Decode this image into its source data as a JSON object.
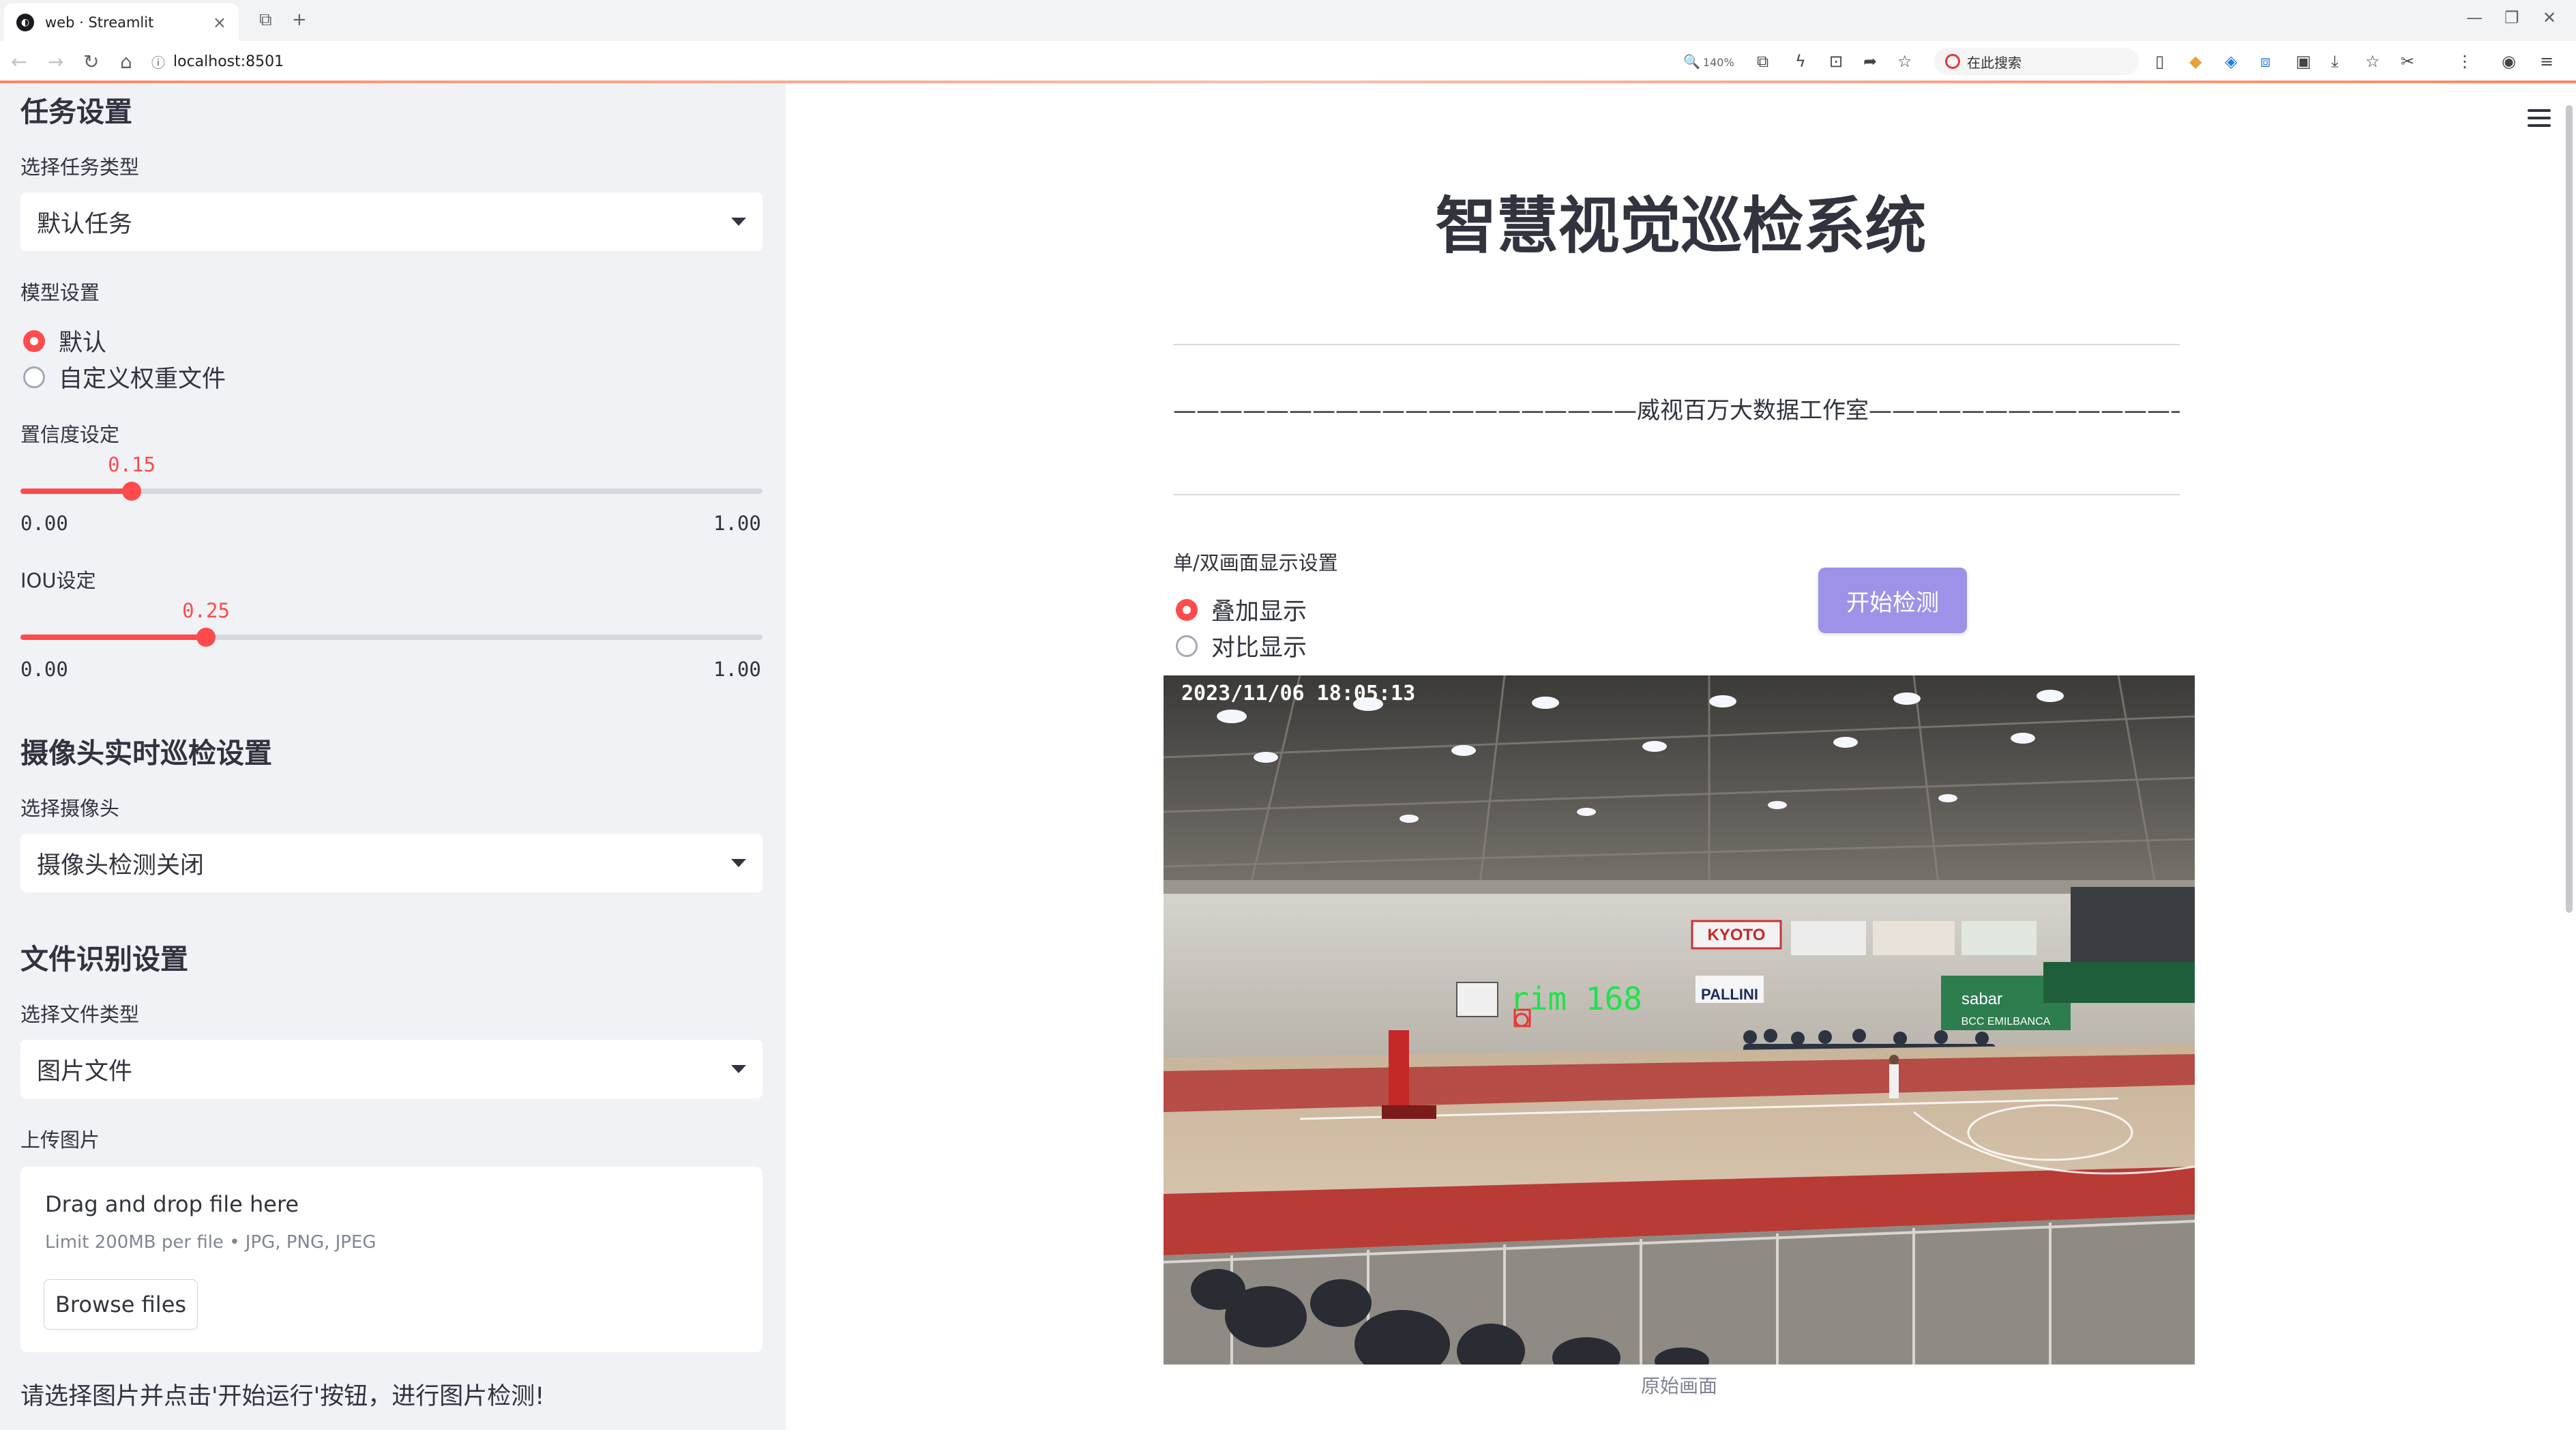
{
  "browser": {
    "tab_title": "web · Streamlit",
    "url": "localhost:8501",
    "zoom": "140%",
    "search_placeholder": "在此搜索"
  },
  "sidebar": {
    "task_header": "任务设置",
    "task_type_label": "选择任务类型",
    "task_type_value": "默认任务",
    "model_label": "模型设置",
    "model_options": [
      "默认",
      "自定义权重文件"
    ],
    "model_selected": 0,
    "confidence": {
      "label": "置信度设定",
      "value": "0.15",
      "min": "0.00",
      "max": "1.00",
      "fraction": 0.15
    },
    "iou": {
      "label": "IOU设定",
      "value": "0.25",
      "min": "0.00",
      "max": "1.00",
      "fraction": 0.25
    },
    "camera_header": "摄像头实时巡检设置",
    "camera_label": "选择摄像头",
    "camera_value": "摄像头检测关闭",
    "file_header": "文件识别设置",
    "file_type_label": "选择文件类型",
    "file_type_value": "图片文件",
    "upload_label": "上传图片",
    "upload_title": "Drag and drop file here",
    "upload_limit": "Limit 200MB per file • JPG, PNG, JPEG",
    "browse_label": "Browse files",
    "note": "请选择图片并点击'开始运行'按钮，进行图片检测!"
  },
  "main": {
    "title": "智慧视觉巡检系统",
    "studio_line": "————————————————————威视百万大数据工作室————————————————————",
    "display_mode_label": "单/双画面显示设置",
    "display_options": [
      "叠加显示",
      "对比显示"
    ],
    "display_selected": 0,
    "start_button": "开始检测",
    "frame_timestamp": "2023/11/06  18:05:13",
    "detection_label": "rim  168",
    "court_sign": "KYOTO",
    "court_sign_2": "PALLINI",
    "court_sign_3": "sabar",
    "court_sign_4": "BCC EMILBANCA",
    "caption": "原始画面"
  }
}
